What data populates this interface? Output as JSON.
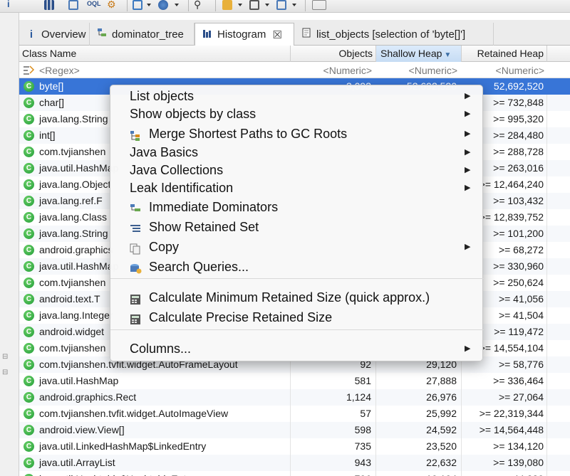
{
  "tabs": [
    {
      "label": "Overview",
      "icon": "info-icon"
    },
    {
      "label": "dominator_tree",
      "icon": "tree-icon"
    },
    {
      "label": "Histogram",
      "icon": "histogram-icon",
      "active": true
    },
    {
      "label": "list_objects [selection of 'byte[]']",
      "icon": "document-icon"
    }
  ],
  "table": {
    "headers": {
      "name": "Class Name",
      "objects": "Objects",
      "shallow": "Shallow Heap",
      "retained": "Retained Heap"
    },
    "filter": {
      "name": "<Regex>",
      "objects": "<Numeric>",
      "shallow": "<Numeric>",
      "retained": "<Numeric>"
    },
    "rows": [
      {
        "name": "byte[]",
        "objects": "3,093",
        "shallow": "52,692,520",
        "retained": "52,692,520"
      },
      {
        "name": "char[]",
        "objects": "",
        "shallow": "",
        "retained": ">= 732,848"
      },
      {
        "name": "java.lang.String",
        "objects": "",
        "shallow": "",
        "retained": ">= 995,320"
      },
      {
        "name": "int[]",
        "objects": "",
        "shallow": "",
        "retained": ">= 284,480"
      },
      {
        "name": "com.tvjianshen",
        "objects": "",
        "shallow": "",
        "retained": ">= 288,728"
      },
      {
        "name": "java.util.HashMap",
        "objects": "",
        "shallow": "",
        "retained": ">= 263,016"
      },
      {
        "name": "java.lang.Object",
        "objects": "",
        "shallow": "",
        "retained": ">= 12,464,240"
      },
      {
        "name": "java.lang.ref.F",
        "objects": "",
        "shallow": "",
        "retained": ">= 103,432"
      },
      {
        "name": "java.lang.Class",
        "objects": "",
        "shallow": "",
        "retained": ">= 12,839,752"
      },
      {
        "name": "java.lang.String",
        "objects": "",
        "shallow": "",
        "retained": ">= 101,200"
      },
      {
        "name": "android.graphics",
        "objects": "",
        "shallow": "",
        "retained": ">= 68,272"
      },
      {
        "name": "java.util.HashMap",
        "objects": "",
        "shallow": "",
        "retained": ">= 330,960"
      },
      {
        "name": "com.tvjianshen",
        "objects": "",
        "shallow": "",
        "retained": ">= 250,624"
      },
      {
        "name": "android.text.T",
        "objects": "",
        "shallow": "",
        "retained": ">= 41,056"
      },
      {
        "name": "java.lang.Integer",
        "objects": "",
        "shallow": "",
        "retained": ">= 41,504"
      },
      {
        "name": "android.widget",
        "objects": "",
        "shallow": "",
        "retained": ">= 119,472"
      },
      {
        "name": "com.tvjianshen",
        "objects": "",
        "shallow": "",
        "retained": ">= 14,554,104"
      },
      {
        "name": "com.tvjianshen.tvfit.widget.AutoFrameLayout",
        "objects": "92",
        "shallow": "29,120",
        "retained": ">= 58,776"
      },
      {
        "name": "java.util.HashMap",
        "objects": "581",
        "shallow": "27,888",
        "retained": ">= 336,464"
      },
      {
        "name": "android.graphics.Rect",
        "objects": "1,124",
        "shallow": "26,976",
        "retained": ">= 27,064"
      },
      {
        "name": "com.tvjianshen.tvfit.widget.AutoImageView",
        "objects": "57",
        "shallow": "25,992",
        "retained": ">= 22,319,344"
      },
      {
        "name": "android.view.View[]",
        "objects": "598",
        "shallow": "24,592",
        "retained": ">= 14,564,448"
      },
      {
        "name": "java.util.LinkedHashMap$LinkedEntry",
        "objects": "735",
        "shallow": "23,520",
        "retained": ">= 134,120"
      },
      {
        "name": "java.util.ArrayList",
        "objects": "943",
        "shallow": "22,632",
        "retained": ">= 139,080"
      },
      {
        "name": "java.util.Hashtable$HashtableEntry",
        "objects": "796",
        "shallow": "19,104",
        "retained": ">= 44,320"
      }
    ]
  },
  "menu": {
    "items": [
      {
        "label": "List objects",
        "submenu": true,
        "icon": ""
      },
      {
        "label": "Show objects by class",
        "submenu": true,
        "icon": ""
      },
      {
        "label": "Merge Shortest Paths to GC Roots",
        "submenu": true,
        "icon": "merge-paths-icon"
      },
      {
        "label": "Java Basics",
        "submenu": true,
        "icon": ""
      },
      {
        "label": "Java Collections",
        "submenu": true,
        "icon": ""
      },
      {
        "label": "Leak Identification",
        "submenu": true,
        "icon": ""
      },
      {
        "label": "Immediate Dominators",
        "submenu": false,
        "icon": "dominators-icon"
      },
      {
        "label": "Show Retained Set",
        "submenu": false,
        "icon": "retained-set-icon"
      },
      {
        "label": "Copy",
        "submenu": true,
        "icon": "copy-icon"
      },
      {
        "label": "Search Queries...",
        "submenu": false,
        "icon": "search-queries-icon"
      },
      {
        "label": "Calculate Minimum Retained Size (quick approx.)",
        "submenu": false,
        "icon": "calculator-icon"
      },
      {
        "label": "Calculate Precise Retained Size",
        "submenu": false,
        "icon": "calculator-icon"
      },
      {
        "label": "Columns...",
        "submenu": true,
        "icon": ""
      }
    ]
  },
  "colors": {
    "selection": "#3875d7",
    "class_icon": "#1e9a35",
    "sorted_header": "#c6dcf4"
  }
}
